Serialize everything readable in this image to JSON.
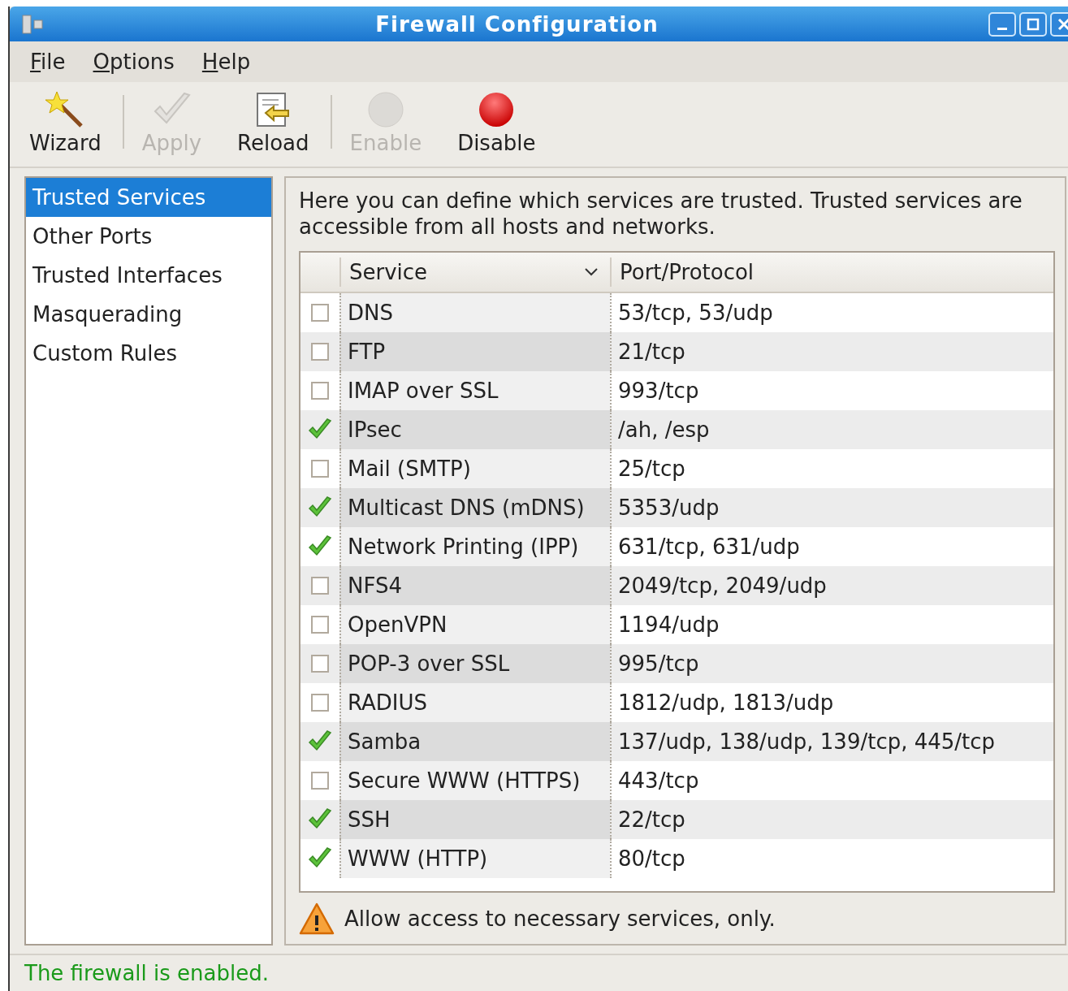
{
  "window": {
    "title": "Firewall Configuration"
  },
  "menu": [
    {
      "label": "File"
    },
    {
      "label": "Options"
    },
    {
      "label": "Help"
    }
  ],
  "toolbar": [
    [
      {
        "label": "Wizard",
        "disabled": false
      }
    ],
    [
      {
        "label": "Apply",
        "disabled": true
      },
      {
        "label": "Reload",
        "disabled": false
      }
    ],
    [
      {
        "label": "Enable",
        "disabled": true
      },
      {
        "label": "Disable",
        "disabled": false
      }
    ]
  ],
  "sidebar": {
    "items": [
      {
        "label": "Trusted Services",
        "selected": true
      },
      {
        "label": "Other Ports",
        "selected": false
      },
      {
        "label": "Trusted Interfaces",
        "selected": false
      },
      {
        "label": "Masquerading",
        "selected": false
      },
      {
        "label": "Custom Rules",
        "selected": false
      }
    ]
  },
  "description": "Here you can define which services are trusted. Trusted services are accessible from all hosts and networks.",
  "table": {
    "columns": [
      {
        "label": "Service",
        "sorted": true
      },
      {
        "label": "Port/Protocol",
        "sorted": false
      }
    ],
    "rows": [
      {
        "checked": false,
        "service": "DNS",
        "ports": "53/tcp, 53/udp"
      },
      {
        "checked": false,
        "service": "FTP",
        "ports": "21/tcp"
      },
      {
        "checked": false,
        "service": "IMAP over SSL",
        "ports": "993/tcp"
      },
      {
        "checked": true,
        "service": "IPsec",
        "ports": "/ah, /esp"
      },
      {
        "checked": false,
        "service": "Mail (SMTP)",
        "ports": "25/tcp"
      },
      {
        "checked": true,
        "service": "Multicast DNS (mDNS)",
        "ports": "5353/udp"
      },
      {
        "checked": true,
        "service": "Network Printing (IPP)",
        "ports": "631/tcp, 631/udp"
      },
      {
        "checked": false,
        "service": "NFS4",
        "ports": "2049/tcp, 2049/udp"
      },
      {
        "checked": false,
        "service": "OpenVPN",
        "ports": "1194/udp"
      },
      {
        "checked": false,
        "service": "POP-3 over SSL",
        "ports": "995/tcp"
      },
      {
        "checked": false,
        "service": "RADIUS",
        "ports": "1812/udp, 1813/udp"
      },
      {
        "checked": true,
        "service": "Samba",
        "ports": "137/udp, 138/udp, 139/tcp, 445/tcp"
      },
      {
        "checked": false,
        "service": "Secure WWW (HTTPS)",
        "ports": "443/tcp"
      },
      {
        "checked": true,
        "service": "SSH",
        "ports": "22/tcp"
      },
      {
        "checked": true,
        "service": "WWW (HTTP)",
        "ports": "80/tcp"
      }
    ]
  },
  "warning": "Allow access to necessary services, only.",
  "status_bar": "The firewall is enabled."
}
